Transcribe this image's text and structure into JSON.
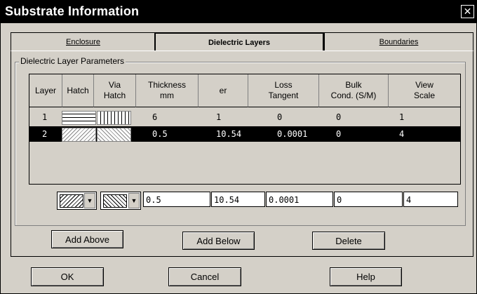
{
  "window": {
    "title": "Substrate Information",
    "close_glyph": "✕"
  },
  "tabs": [
    {
      "label": "Enclosure",
      "active": false
    },
    {
      "label": "Dielectric Layers",
      "active": true
    },
    {
      "label": "Boundaries",
      "active": false
    }
  ],
  "group": {
    "label": "Dielectric Layer Parameters"
  },
  "columns": [
    "Layer",
    "Hatch",
    "Via\nHatch",
    "Thickness\nmm",
    "er",
    "Loss\nTangent",
    "Bulk\nCond. (S/M)",
    "View\nScale"
  ],
  "rows": [
    {
      "layer": "1",
      "thickness": "6",
      "er": "1",
      "loss": "0",
      "bulk": "0",
      "scale": "1",
      "selected": false
    },
    {
      "layer": "2",
      "thickness": "0.5",
      "er": "10.54",
      "loss": "0.0001",
      "bulk": "0",
      "scale": "4",
      "selected": true
    }
  ],
  "editor": {
    "thickness": "0.5",
    "er": "10.54",
    "loss": "0.0001",
    "bulk": "0",
    "scale": "4"
  },
  "buttons": {
    "add_above": "Add Above",
    "add_below": "Add Below",
    "delete": "Delete",
    "ok": "OK",
    "cancel": "Cancel",
    "help": "Help"
  },
  "icons": {
    "close": "close-icon",
    "dropdown": "chevron-down-icon"
  }
}
